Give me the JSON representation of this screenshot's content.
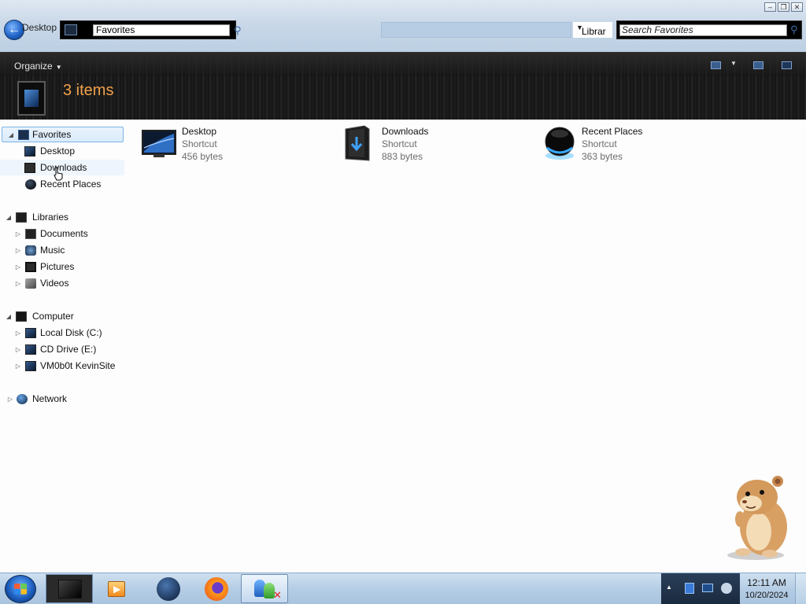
{
  "window": {
    "title_ghost": "Desktop",
    "address_path": "Favorites",
    "libraries_dropdown": "Librar",
    "search_placeholder": "Search Favorites",
    "controls": [
      "minimize",
      "restore",
      "close"
    ]
  },
  "toolbar": {
    "organize_label": "Organize",
    "item_count": "3 items"
  },
  "navigation": {
    "favorites": {
      "label": "Favorites",
      "items": [
        {
          "label": "Desktop",
          "icon": "desktop-icon"
        },
        {
          "label": "Downloads",
          "icon": "downloads-icon"
        },
        {
          "label": "Recent Places",
          "icon": "recent-places-icon"
        }
      ]
    },
    "libraries": {
      "label": "Libraries",
      "items": [
        {
          "label": "Documents",
          "icon": "documents-icon"
        },
        {
          "label": "Music",
          "icon": "music-icon"
        },
        {
          "label": "Pictures",
          "icon": "pictures-icon"
        },
        {
          "label": "Videos",
          "icon": "videos-icon"
        }
      ]
    },
    "computer": {
      "label": "Computer",
      "items": [
        {
          "label": "Local Disk (C:)",
          "icon": "local-disk-icon"
        },
        {
          "label": "CD Drive (E:)",
          "icon": "cd-drive-icon"
        },
        {
          "label": "VM0b0t KevinSite",
          "icon": "network-drive-icon"
        }
      ]
    },
    "network": {
      "label": "Network"
    }
  },
  "content": {
    "items": [
      {
        "name": "Desktop",
        "type": "Shortcut",
        "size": "456 bytes",
        "icon": "desktop-shortcut-icon"
      },
      {
        "name": "Downloads",
        "type": "Shortcut",
        "size": "883 bytes",
        "icon": "downloads-shortcut-icon"
      },
      {
        "name": "Recent Places",
        "type": "Shortcut",
        "size": "363 bytes",
        "icon": "recent-places-shortcut-icon"
      }
    ]
  },
  "taskbar": {
    "buttons": [
      "explorer",
      "media-player",
      "globe-browser",
      "firefox",
      "users-manager"
    ],
    "clock_time": "12:11 AM",
    "clock_date": "10/20/2024"
  },
  "colors": {
    "header_text": "#f0a04a",
    "selection_border": "#7fb4e6",
    "header_bg": "#161616"
  }
}
